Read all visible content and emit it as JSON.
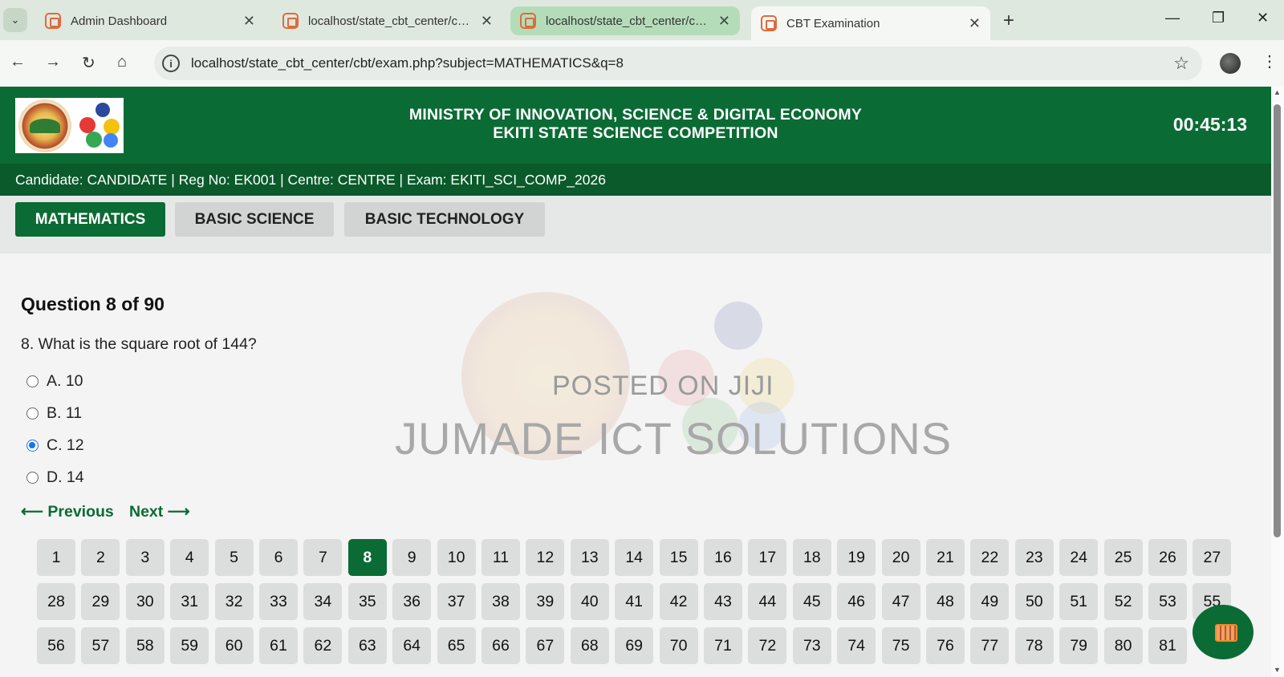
{
  "browser": {
    "tabs": [
      {
        "title": "Admin Dashboard"
      },
      {
        "title": "localhost/state_cbt_center/cbt/s"
      },
      {
        "title": "localhost/state_cbt_center/cbt/s"
      },
      {
        "title": "CBT Examination"
      }
    ],
    "url": "localhost/state_cbt_center/cbt/exam.php?subject=MATHEMATICS&q=8"
  },
  "header": {
    "ministry": "MINISTRY OF INNOVATION, SCIENCE & DIGITAL ECONOMY",
    "competition": "EKITI STATE SCIENCE COMPETITION",
    "timer": "00:45:13"
  },
  "candidate_line": "Candidate: CANDIDATE | Reg No: EK001 | Centre: CENTRE | Exam: EKITI_SCI_COMP_2026",
  "subjects": [
    "MATHEMATICS",
    "BASIC SCIENCE",
    "BASIC TECHNOLOGY"
  ],
  "active_subject": "MATHEMATICS",
  "question": {
    "heading": "Question 8 of 90",
    "text": "8. What is the square root of 144?",
    "options": [
      "A. 10",
      "B. 11",
      "C. 12",
      "D. 14"
    ],
    "selected_index": 2
  },
  "nav": {
    "previous": "⟵ Previous",
    "next": "Next ⟶"
  },
  "watermark": {
    "posted": "POSTED ON JIJI",
    "brand": "JUMADE ICT SOLUTIONS"
  },
  "question_grid": {
    "visible_numbers": [
      "1",
      "2",
      "3",
      "4",
      "5",
      "6",
      "7",
      "8",
      "9",
      "10",
      "11",
      "12",
      "13",
      "14",
      "15",
      "16",
      "17",
      "18",
      "19",
      "20",
      "21",
      "22",
      "23",
      "24",
      "25",
      "26",
      "27",
      "28",
      "29",
      "30",
      "31",
      "32",
      "33",
      "34",
      "35",
      "36",
      "37",
      "38",
      "39",
      "40",
      "41",
      "42",
      "43",
      "44",
      "45",
      "46",
      "47",
      "48",
      "49",
      "50",
      "51",
      "52",
      "53",
      "55",
      "56",
      "57",
      "58",
      "59",
      "60",
      "61",
      "62",
      "63",
      "64",
      "65",
      "66",
      "67",
      "68",
      "69",
      "70",
      "71",
      "72",
      "73",
      "74",
      "75",
      "76",
      "77",
      "78",
      "79",
      "80",
      "81"
    ],
    "current": "8"
  },
  "colors": {
    "primary_green": "#0b6b34",
    "dark_green": "#0a5a2b",
    "selected_radio": "#1a73e8"
  },
  "icons": {
    "calculator": "calculator-icon"
  }
}
